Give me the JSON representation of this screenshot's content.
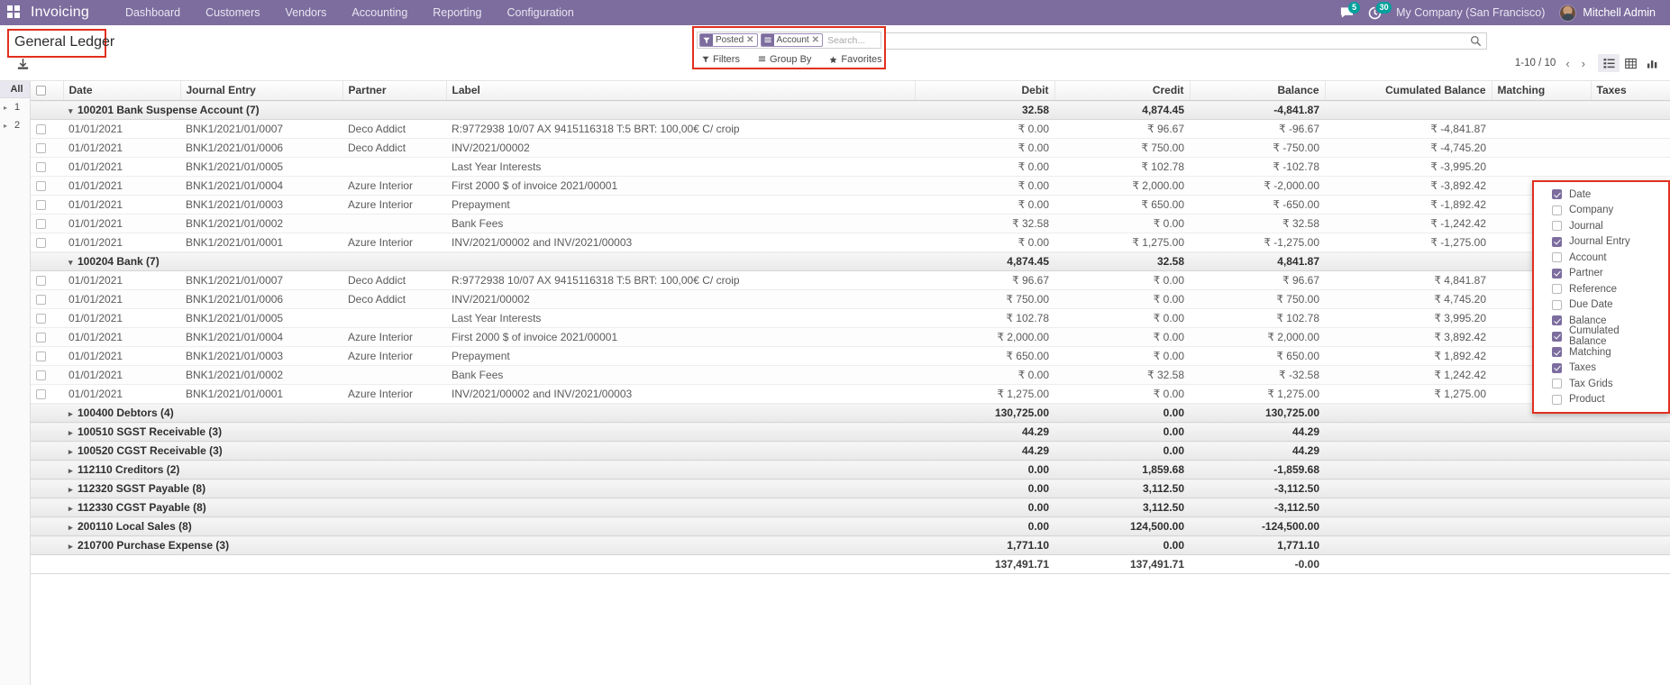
{
  "navbar": {
    "apps_icon": "apps-grid-icon",
    "brand": "Invoicing",
    "menu": [
      {
        "label": "Dashboard"
      },
      {
        "label": "Customers"
      },
      {
        "label": "Vendors"
      },
      {
        "label": "Accounting"
      },
      {
        "label": "Reporting"
      },
      {
        "label": "Configuration"
      }
    ],
    "messages_badge": "5",
    "activities_badge": "30",
    "company": "My Company (San Francisco)",
    "user": "Mitchell Admin"
  },
  "control_panel": {
    "title": "General Ledger",
    "download_icon": "download-icon",
    "search": {
      "placeholder": "Search...",
      "facets": [
        {
          "label": "Posted",
          "icon": "filter-icon"
        },
        {
          "label": "Account",
          "icon": "group-by-icon"
        }
      ],
      "search_icon": "magnifier-icon"
    },
    "actions": [
      {
        "label": "Filters",
        "icon": "filter-icon"
      },
      {
        "label": "Group By",
        "icon": "group-by-icon"
      },
      {
        "label": "Favorites",
        "icon": "star-icon"
      }
    ],
    "pager": {
      "range": "1-10 / 10",
      "prev_icon": "chevron-left-icon",
      "next_icon": "chevron-right-icon"
    },
    "views": [
      {
        "name": "list-view",
        "icon": "list-icon",
        "active": true
      },
      {
        "name": "pivot-view",
        "icon": "table-icon",
        "active": false
      },
      {
        "name": "graph-view",
        "icon": "bar-chart-icon",
        "active": false
      }
    ]
  },
  "left_rail": {
    "all_label": "All",
    "items": [
      {
        "label": "1"
      },
      {
        "label": "2"
      }
    ]
  },
  "table": {
    "columns": [
      {
        "label": "Date",
        "align": "left"
      },
      {
        "label": "Journal Entry",
        "align": "left"
      },
      {
        "label": "Partner",
        "align": "left"
      },
      {
        "label": "Label",
        "align": "left"
      },
      {
        "label": "Debit",
        "align": "right"
      },
      {
        "label": "Credit",
        "align": "right"
      },
      {
        "label": "Balance",
        "align": "right"
      },
      {
        "label": "Cumulated Balance",
        "align": "right"
      },
      {
        "label": "Matching",
        "align": "left"
      },
      {
        "label": "Taxes",
        "align": "left"
      }
    ],
    "optional_columns_icon": "vertical-dots-icon",
    "rows": [
      {
        "type": "group",
        "expanded": true,
        "label": "100201 Bank Suspense Account (7)",
        "debit": "32.58",
        "credit": "4,874.45",
        "balance": "-4,841.87",
        "cumulated": "",
        "matching": "",
        "taxes": ""
      },
      {
        "type": "line",
        "date": "01/01/2021",
        "entry": "BNK1/2021/01/0007",
        "partner": "Deco Addict",
        "label": "R:9772938 10/07 AX 9415116318 T:5 BRT: 100,00€ C/ croip",
        "debit": "₹ 0.00",
        "credit": "₹ 96.67",
        "balance": "₹ -96.67",
        "cumulated": "₹ -4,841.87",
        "matching": "",
        "taxes": ""
      },
      {
        "type": "line",
        "date": "01/01/2021",
        "entry": "BNK1/2021/01/0006",
        "partner": "Deco Addict",
        "label": "INV/2021/00002",
        "debit": "₹ 0.00",
        "credit": "₹ 750.00",
        "balance": "₹ -750.00",
        "cumulated": "₹ -4,745.20",
        "matching": "",
        "taxes": ""
      },
      {
        "type": "line",
        "date": "01/01/2021",
        "entry": "BNK1/2021/01/0005",
        "partner": "",
        "label": "Last Year Interests",
        "debit": "₹ 0.00",
        "credit": "₹ 102.78",
        "balance": "₹ -102.78",
        "cumulated": "₹ -3,995.20",
        "matching": "",
        "taxes": ""
      },
      {
        "type": "line",
        "date": "01/01/2021",
        "entry": "BNK1/2021/01/0004",
        "partner": "Azure Interior",
        "label": "First 2000 $ of invoice 2021/00001",
        "debit": "₹ 0.00",
        "credit": "₹ 2,000.00",
        "balance": "₹ -2,000.00",
        "cumulated": "₹ -3,892.42",
        "matching": "",
        "taxes": ""
      },
      {
        "type": "line",
        "date": "01/01/2021",
        "entry": "BNK1/2021/01/0003",
        "partner": "Azure Interior",
        "label": "Prepayment",
        "debit": "₹ 0.00",
        "credit": "₹ 650.00",
        "balance": "₹ -650.00",
        "cumulated": "₹ -1,892.42",
        "matching": "",
        "taxes": ""
      },
      {
        "type": "line",
        "date": "01/01/2021",
        "entry": "BNK1/2021/01/0002",
        "partner": "",
        "label": "Bank Fees",
        "debit": "₹ 32.58",
        "credit": "₹ 0.00",
        "balance": "₹ 32.58",
        "cumulated": "₹ -1,242.42",
        "matching": "",
        "taxes": ""
      },
      {
        "type": "line",
        "date": "01/01/2021",
        "entry": "BNK1/2021/01/0001",
        "partner": "Azure Interior",
        "label": "INV/2021/00002 and INV/2021/00003",
        "debit": "₹ 0.00",
        "credit": "₹ 1,275.00",
        "balance": "₹ -1,275.00",
        "cumulated": "₹ -1,275.00",
        "matching": "",
        "taxes": ""
      },
      {
        "type": "group",
        "expanded": true,
        "label": "100204 Bank (7)",
        "debit": "4,874.45",
        "credit": "32.58",
        "balance": "4,841.87",
        "cumulated": "",
        "matching": "",
        "taxes": ""
      },
      {
        "type": "line",
        "date": "01/01/2021",
        "entry": "BNK1/2021/01/0007",
        "partner": "Deco Addict",
        "label": "R:9772938 10/07 AX 9415116318 T:5 BRT: 100,00€ C/ croip",
        "debit": "₹ 96.67",
        "credit": "₹ 0.00",
        "balance": "₹ 96.67",
        "cumulated": "₹ 4,841.87",
        "matching": "",
        "taxes": ""
      },
      {
        "type": "line",
        "date": "01/01/2021",
        "entry": "BNK1/2021/01/0006",
        "partner": "Deco Addict",
        "label": "INV/2021/00002",
        "debit": "₹ 750.00",
        "credit": "₹ 0.00",
        "balance": "₹ 750.00",
        "cumulated": "₹ 4,745.20",
        "matching": "",
        "taxes": ""
      },
      {
        "type": "line",
        "date": "01/01/2021",
        "entry": "BNK1/2021/01/0005",
        "partner": "",
        "label": "Last Year Interests",
        "debit": "₹ 102.78",
        "credit": "₹ 0.00",
        "balance": "₹ 102.78",
        "cumulated": "₹ 3,995.20",
        "matching": "",
        "taxes": ""
      },
      {
        "type": "line",
        "date": "01/01/2021",
        "entry": "BNK1/2021/01/0004",
        "partner": "Azure Interior",
        "label": "First 2000 $ of invoice 2021/00001",
        "debit": "₹ 2,000.00",
        "credit": "₹ 0.00",
        "balance": "₹ 2,000.00",
        "cumulated": "₹ 3,892.42",
        "matching": "",
        "taxes": ""
      },
      {
        "type": "line",
        "date": "01/01/2021",
        "entry": "BNK1/2021/01/0003",
        "partner": "Azure Interior",
        "label": "Prepayment",
        "debit": "₹ 650.00",
        "credit": "₹ 0.00",
        "balance": "₹ 650.00",
        "cumulated": "₹ 1,892.42",
        "matching": "",
        "taxes": ""
      },
      {
        "type": "line",
        "date": "01/01/2021",
        "entry": "BNK1/2021/01/0002",
        "partner": "",
        "label": "Bank Fees",
        "debit": "₹ 0.00",
        "credit": "₹ 32.58",
        "balance": "₹ -32.58",
        "cumulated": "₹ 1,242.42",
        "matching": "",
        "taxes": ""
      },
      {
        "type": "line",
        "date": "01/01/2021",
        "entry": "BNK1/2021/01/0001",
        "partner": "Azure Interior",
        "label": "INV/2021/00002 and INV/2021/00003",
        "debit": "₹ 1,275.00",
        "credit": "₹ 0.00",
        "balance": "₹ 1,275.00",
        "cumulated": "₹ 1,275.00",
        "matching": "",
        "taxes": ""
      },
      {
        "type": "group",
        "expanded": false,
        "label": "100400 Debtors (4)",
        "debit": "130,725.00",
        "credit": "0.00",
        "balance": "130,725.00",
        "cumulated": "",
        "matching": "",
        "taxes": ""
      },
      {
        "type": "group",
        "expanded": false,
        "label": "100510 SGST Receivable (3)",
        "debit": "44.29",
        "credit": "0.00",
        "balance": "44.29",
        "cumulated": "",
        "matching": "",
        "taxes": ""
      },
      {
        "type": "group",
        "expanded": false,
        "label": "100520 CGST Receivable (3)",
        "debit": "44.29",
        "credit": "0.00",
        "balance": "44.29",
        "cumulated": "",
        "matching": "",
        "taxes": ""
      },
      {
        "type": "group",
        "expanded": false,
        "label": "112110 Creditors (2)",
        "debit": "0.00",
        "credit": "1,859.68",
        "balance": "-1,859.68",
        "cumulated": "",
        "matching": "",
        "taxes": ""
      },
      {
        "type": "group",
        "expanded": false,
        "label": "112320 SGST Payable (8)",
        "debit": "0.00",
        "credit": "3,112.50",
        "balance": "-3,112.50",
        "cumulated": "",
        "matching": "",
        "taxes": ""
      },
      {
        "type": "group",
        "expanded": false,
        "label": "112330 CGST Payable (8)",
        "debit": "0.00",
        "credit": "3,112.50",
        "balance": "-3,112.50",
        "cumulated": "",
        "matching": "",
        "taxes": ""
      },
      {
        "type": "group",
        "expanded": false,
        "label": "200110 Local Sales (8)",
        "debit": "0.00",
        "credit": "124,500.00",
        "balance": "-124,500.00",
        "cumulated": "",
        "matching": "",
        "taxes": ""
      },
      {
        "type": "group",
        "expanded": false,
        "label": "210700 Purchase Expense (3)",
        "debit": "1,771.10",
        "credit": "0.00",
        "balance": "1,771.10",
        "cumulated": "",
        "matching": "",
        "taxes": ""
      },
      {
        "type": "total",
        "label": "",
        "debit": "137,491.71",
        "credit": "137,491.71",
        "balance": "-0.00",
        "cumulated": "",
        "matching": "",
        "taxes": ""
      }
    ]
  },
  "optional_columns_dropdown": {
    "items": [
      {
        "label": "Date",
        "checked": true
      },
      {
        "label": "Company",
        "checked": false
      },
      {
        "label": "Journal",
        "checked": false
      },
      {
        "label": "Journal Entry",
        "checked": true
      },
      {
        "label": "Account",
        "checked": false
      },
      {
        "label": "Partner",
        "checked": true
      },
      {
        "label": "Reference",
        "checked": false
      },
      {
        "label": "Due Date",
        "checked": false
      },
      {
        "label": "Balance",
        "checked": true
      },
      {
        "label": "Cumulated Balance",
        "checked": true
      },
      {
        "label": "Matching",
        "checked": true
      },
      {
        "label": "Taxes",
        "checked": true
      },
      {
        "label": "Tax Grids",
        "checked": false
      },
      {
        "label": "Product",
        "checked": false
      }
    ]
  },
  "colors": {
    "brand_purple": "#7c6d9e",
    "badge_teal": "#00a09d",
    "highlight_red": "#e0301e"
  }
}
